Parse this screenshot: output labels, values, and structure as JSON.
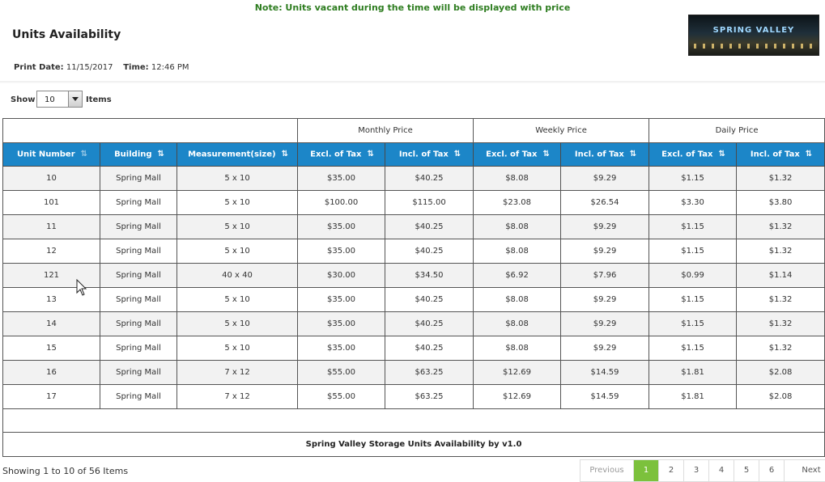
{
  "note": "Note: Units vacant during the time will be displayed with price",
  "title": "Units Availability",
  "print": {
    "date_label": "Print Date:",
    "date": "11/15/2017",
    "time_label": "Time:",
    "time": "12:46 PM"
  },
  "logo_text": "SPRING VALLEY",
  "controls": {
    "show_label": "Show",
    "page_size": "10",
    "items_label": "Items"
  },
  "table": {
    "groups": [
      "Monthly Price",
      "Weekly Price",
      "Daily Price"
    ],
    "columns": [
      "Unit Number",
      "Building",
      "Measurement(size)",
      "Excl. of Tax",
      "Incl. of Tax",
      "Excl. of Tax",
      "Incl. of Tax",
      "Excl. of Tax",
      "Incl. of Tax"
    ],
    "rows": [
      [
        "10",
        "Spring Mall",
        "5 x 10",
        "$35.00",
        "$40.25",
        "$8.08",
        "$9.29",
        "$1.15",
        "$1.32"
      ],
      [
        "101",
        "Spring Mall",
        "5 x 10",
        "$100.00",
        "$115.00",
        "$23.08",
        "$26.54",
        "$3.30",
        "$3.80"
      ],
      [
        "11",
        "Spring Mall",
        "5 x 10",
        "$35.00",
        "$40.25",
        "$8.08",
        "$9.29",
        "$1.15",
        "$1.32"
      ],
      [
        "12",
        "Spring Mall",
        "5 x 10",
        "$35.00",
        "$40.25",
        "$8.08",
        "$9.29",
        "$1.15",
        "$1.32"
      ],
      [
        "121",
        "Spring Mall",
        "40 x 40",
        "$30.00",
        "$34.50",
        "$6.92",
        "$7.96",
        "$0.99",
        "$1.14"
      ],
      [
        "13",
        "Spring Mall",
        "5 x 10",
        "$35.00",
        "$40.25",
        "$8.08",
        "$9.29",
        "$1.15",
        "$1.32"
      ],
      [
        "14",
        "Spring Mall",
        "5 x 10",
        "$35.00",
        "$40.25",
        "$8.08",
        "$9.29",
        "$1.15",
        "$1.32"
      ],
      [
        "15",
        "Spring Mall",
        "5 x 10",
        "$35.00",
        "$40.25",
        "$8.08",
        "$9.29",
        "$1.15",
        "$1.32"
      ],
      [
        "16",
        "Spring Mall",
        "7 x 12",
        "$55.00",
        "$63.25",
        "$12.69",
        "$14.59",
        "$1.81",
        "$2.08"
      ],
      [
        "17",
        "Spring Mall",
        "7 x 12",
        "$55.00",
        "$63.25",
        "$12.69",
        "$14.59",
        "$1.81",
        "$2.08"
      ]
    ],
    "footer": "Spring Valley Storage Units Availability by v1.0"
  },
  "showing": "Showing 1 to 10 of 56 Items",
  "pagination": {
    "previous": "Previous",
    "pages": [
      "1",
      "2",
      "3",
      "4",
      "5",
      "6"
    ],
    "active": "1",
    "next": "Next"
  },
  "colors": {
    "header_bg": "#1c86c8",
    "note": "#2e7d20",
    "active_page": "#7cc13c"
  }
}
